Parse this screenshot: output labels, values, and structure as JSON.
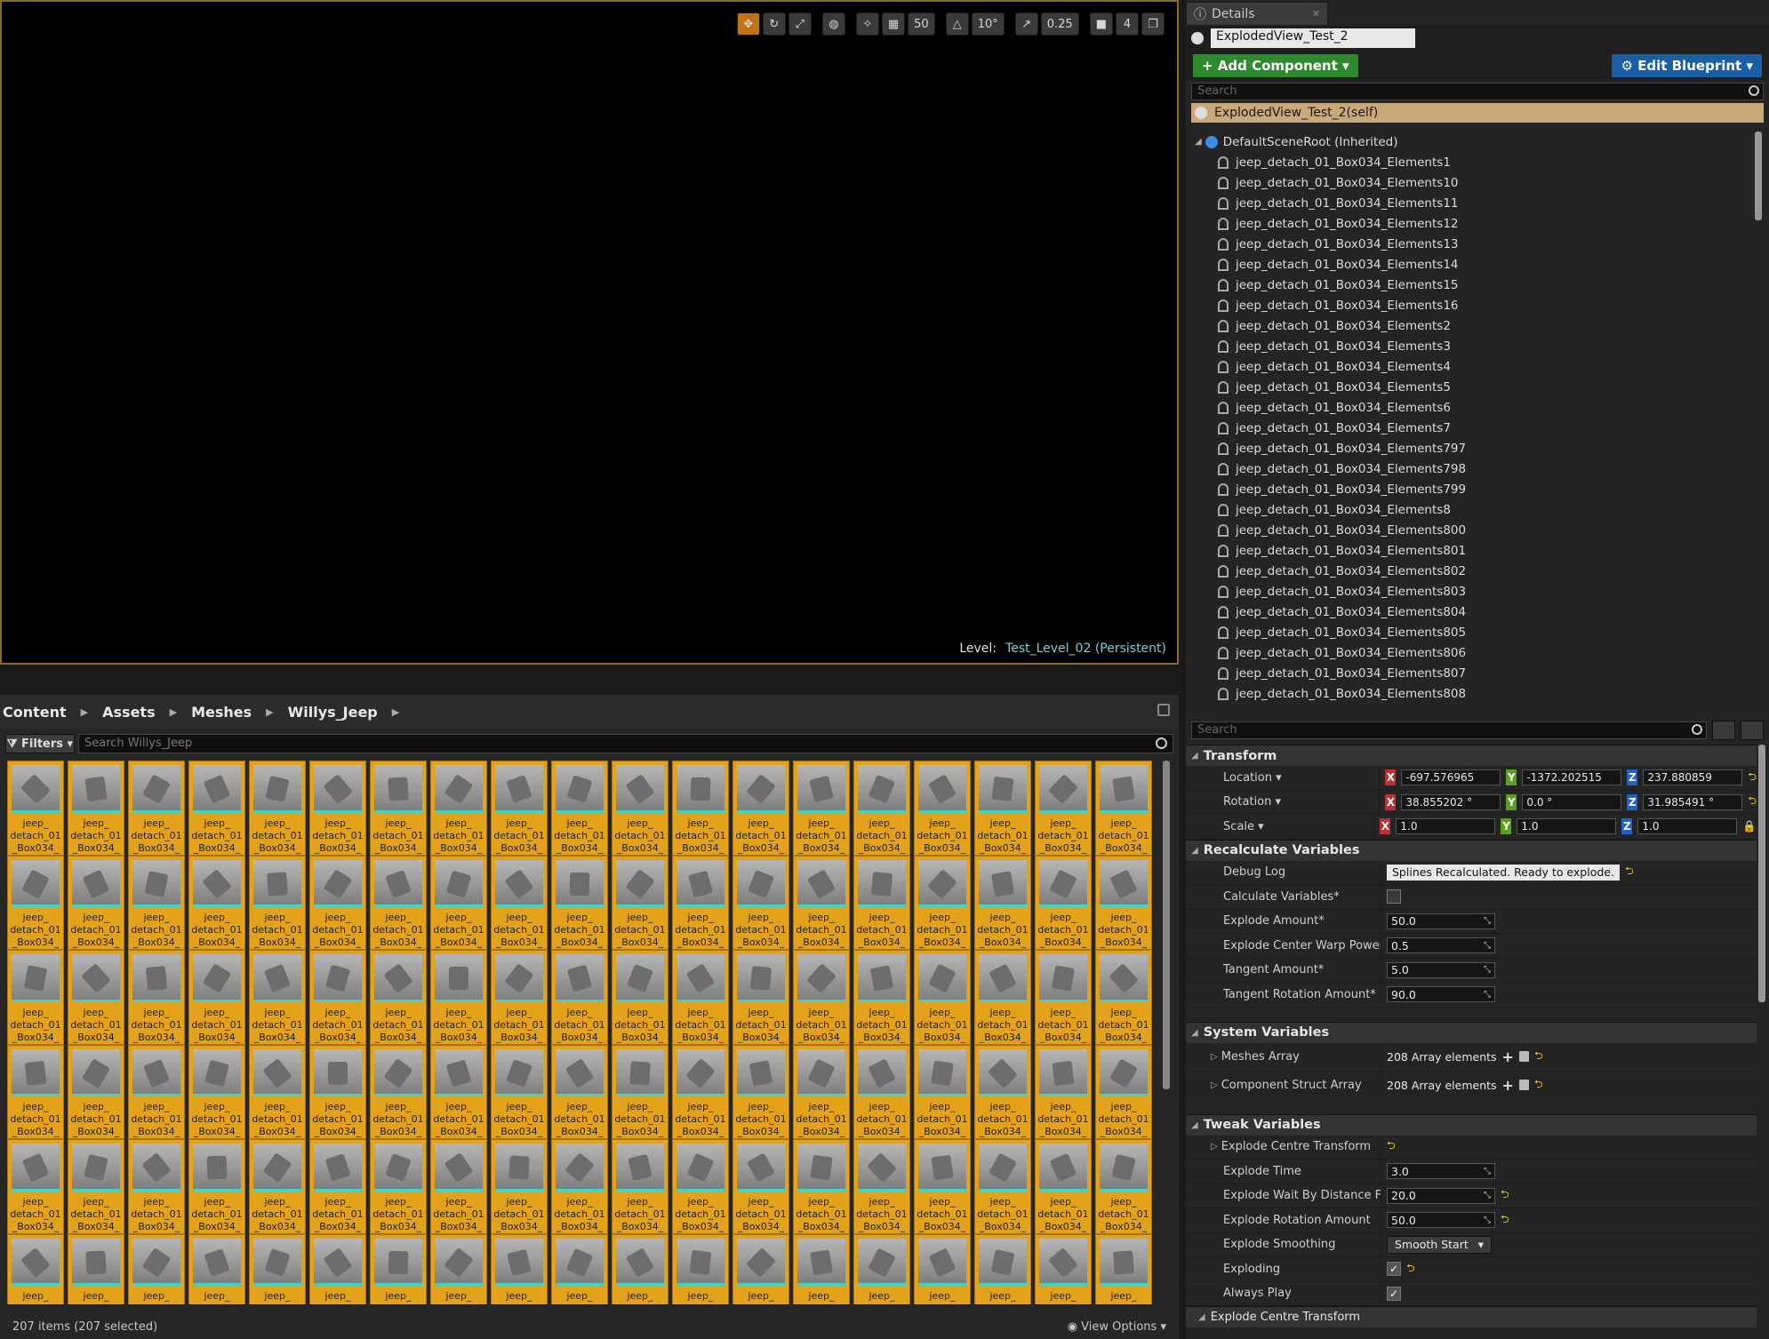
{
  "viewport": {
    "toolbar": {
      "grid_snap": "50",
      "rot_snap": "10°",
      "scale_snap": "0.25",
      "cam_speed": "4"
    },
    "level_label": "Level:",
    "level_name": "Test_Level_02 (Persistent)"
  },
  "content_browser": {
    "breadcrumb": [
      "Content",
      "Assets",
      "Meshes",
      "Willys_Jeep"
    ],
    "filters_label": "Filters",
    "search_placeholder": "Search Willys_Jeep",
    "tile_label_lines": [
      "jeep_",
      "detach_01",
      "_Box034_"
    ],
    "status": "207 items (207 selected)",
    "view_options": "View Options"
  },
  "details": {
    "tab_title": "Details",
    "object_name": "ExplodedView_Test_2",
    "add_component": "+ Add Component",
    "edit_blueprint": "Edit Blueprint",
    "search_placeholder": "Search",
    "self_label": "ExplodedView_Test_2(self)",
    "root_label": "DefaultSceneRoot (Inherited)",
    "components": [
      "jeep_detach_01_Box034_Elements1",
      "jeep_detach_01_Box034_Elements10",
      "jeep_detach_01_Box034_Elements11",
      "jeep_detach_01_Box034_Elements12",
      "jeep_detach_01_Box034_Elements13",
      "jeep_detach_01_Box034_Elements14",
      "jeep_detach_01_Box034_Elements15",
      "jeep_detach_01_Box034_Elements16",
      "jeep_detach_01_Box034_Elements2",
      "jeep_detach_01_Box034_Elements3",
      "jeep_detach_01_Box034_Elements4",
      "jeep_detach_01_Box034_Elements5",
      "jeep_detach_01_Box034_Elements6",
      "jeep_detach_01_Box034_Elements7",
      "jeep_detach_01_Box034_Elements797",
      "jeep_detach_01_Box034_Elements798",
      "jeep_detach_01_Box034_Elements799",
      "jeep_detach_01_Box034_Elements8",
      "jeep_detach_01_Box034_Elements800",
      "jeep_detach_01_Box034_Elements801",
      "jeep_detach_01_Box034_Elements802",
      "jeep_detach_01_Box034_Elements803",
      "jeep_detach_01_Box034_Elements804",
      "jeep_detach_01_Box034_Elements805",
      "jeep_detach_01_Box034_Elements806",
      "jeep_detach_01_Box034_Elements807",
      "jeep_detach_01_Box034_Elements808"
    ],
    "prop_search_placeholder": "Search",
    "transform": {
      "title": "Transform",
      "location_label": "Location",
      "location": [
        "-697.576965",
        "-1372.202515",
        "237.880859"
      ],
      "rotation_label": "Rotation",
      "rotation": [
        "38.855202 °",
        "0.0 °",
        "31.985491 °"
      ],
      "scale_label": "Scale",
      "scale": [
        "1.0",
        "1.0",
        "1.0"
      ]
    },
    "recalc": {
      "title": "Recalculate Variables",
      "debug_log_label": "Debug Log",
      "debug_log": "Splines Recalculated. Ready to explode.",
      "calc_label": "Calculate Variables*",
      "explode_amount_label": "Explode Amount*",
      "explode_amount": "50.0",
      "warp_label": "Explode Center Warp Power*",
      "warp": "0.5",
      "tangent_label": "Tangent Amount*",
      "tangent": "5.0",
      "tangent_rot_label": "Tangent Rotation Amount*",
      "tangent_rot": "90.0"
    },
    "system": {
      "title": "System Variables",
      "meshes_label": "Meshes Array",
      "meshes_value": "208 Array elements",
      "struct_label": "Component Struct Array",
      "struct_value": "208 Array elements"
    },
    "tweak": {
      "title": "Tweak Variables",
      "centre_label": "Explode Centre Transform",
      "time_label": "Explode Time",
      "time": "3.0",
      "wait_label": "Explode Wait By Distance Factor",
      "wait": "20.0",
      "rot_label": "Explode Rotation Amount",
      "rot": "50.0",
      "smooth_label": "Explode Smoothing",
      "smooth": "Smooth Start",
      "exploding_label": "Exploding",
      "always_label": "Always Play",
      "bottom_cat": "Explode Centre Transform"
    }
  }
}
